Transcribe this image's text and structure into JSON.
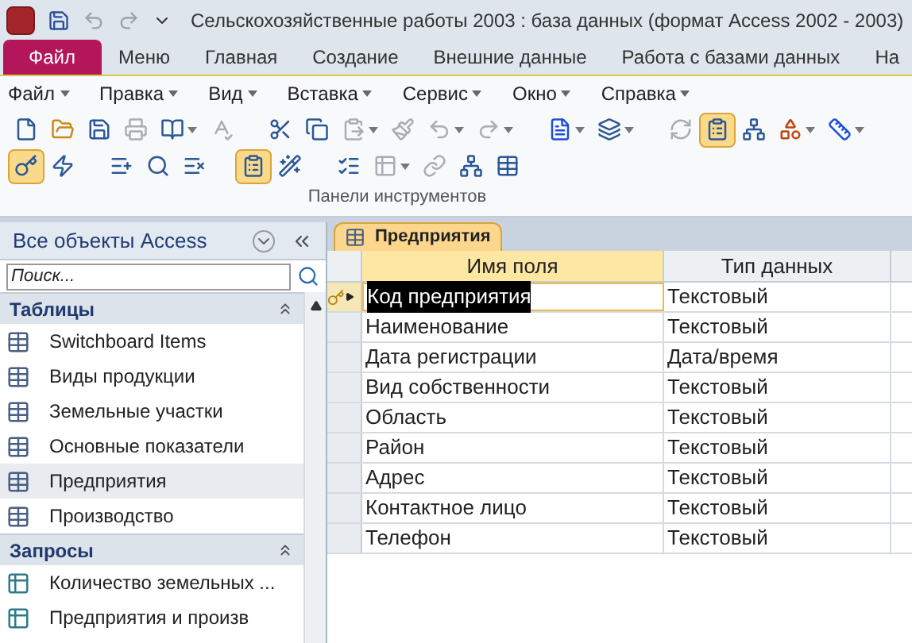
{
  "window": {
    "title": "Сельскохозяйственные работы 2003 : база данных (формат Access 2002 - 2003)"
  },
  "ribbon_tabs": [
    {
      "label": "Файл",
      "kind": "file"
    },
    {
      "label": "Меню",
      "kind": "tab"
    },
    {
      "label": "Главная",
      "kind": "tab"
    },
    {
      "label": "Создание",
      "kind": "tab"
    },
    {
      "label": "Внешние данные",
      "kind": "tab"
    },
    {
      "label": "Работа с базами данных",
      "kind": "tab"
    },
    {
      "label": "На",
      "kind": "tab"
    }
  ],
  "menu_bar": [
    "Файл",
    "Правка",
    "Вид",
    "Вставка",
    "Сервис",
    "Окно",
    "Справка"
  ],
  "toolbar_rows": [
    [
      {
        "pressed": false,
        "disabled": false,
        "dropdown": false
      },
      {
        "pressed": false,
        "disabled": false,
        "dropdown": false
      },
      {
        "pressed": false,
        "disabled": false,
        "dropdown": false
      },
      {
        "pressed": false,
        "disabled": true,
        "dropdown": false
      },
      {
        "pressed": false,
        "disabled": false,
        "dropdown": true
      },
      {
        "pressed": false,
        "disabled": true,
        "dropdown": false,
        "gap": true
      },
      {
        "pressed": false,
        "disabled": false,
        "dropdown": false
      },
      {
        "pressed": false,
        "disabled": false,
        "dropdown": false
      },
      {
        "pressed": false,
        "disabled": true,
        "dropdown": true
      },
      {
        "pressed": false,
        "disabled": true,
        "dropdown": false
      },
      {
        "pressed": false,
        "disabled": true,
        "dropdown": true
      },
      {
        "pressed": false,
        "disabled": true,
        "dropdown": true,
        "gap": true
      },
      {
        "pressed": false,
        "disabled": false,
        "dropdown": true
      },
      {
        "pressed": false,
        "disabled": false,
        "dropdown": true,
        "gap": true
      },
      {
        "pressed": false,
        "disabled": true,
        "dropdown": false
      },
      {
        "pressed": true,
        "disabled": false,
        "dropdown": false
      },
      {
        "pressed": false,
        "disabled": false,
        "dropdown": false
      },
      {
        "pressed": false,
        "disabled": false,
        "dropdown": true
      },
      {
        "pressed": false,
        "disabled": false,
        "dropdown": true
      }
    ],
    [
      {
        "pressed": true,
        "disabled": false,
        "dropdown": false
      },
      {
        "pressed": false,
        "disabled": false,
        "dropdown": false,
        "gap": true
      },
      {
        "pressed": false,
        "disabled": false,
        "dropdown": false
      },
      {
        "pressed": false,
        "disabled": false,
        "dropdown": false
      },
      {
        "pressed": false,
        "disabled": false,
        "dropdown": false,
        "gap": true
      },
      {
        "pressed": true,
        "disabled": false,
        "dropdown": false
      },
      {
        "pressed": false,
        "disabled": false,
        "dropdown": false,
        "gap": true
      },
      {
        "pressed": false,
        "disabled": false,
        "dropdown": false
      },
      {
        "pressed": false,
        "disabled": true,
        "dropdown": true
      },
      {
        "pressed": false,
        "disabled": true,
        "dropdown": false
      },
      {
        "pressed": false,
        "disabled": false,
        "dropdown": false
      },
      {
        "pressed": false,
        "disabled": false,
        "dropdown": false
      }
    ]
  ],
  "ribbon_group_label": "Панели инструментов",
  "nav_pane": {
    "title": "Все объекты Access",
    "search": {
      "placeholder": "Поиск..."
    },
    "groups": [
      {
        "label": "Таблицы",
        "kind": "table",
        "items": [
          {
            "label": "Switchboard Items",
            "selected": false
          },
          {
            "label": "Виды продукции",
            "selected": false
          },
          {
            "label": "Земельные участки",
            "selected": false
          },
          {
            "label": "Основные показатели",
            "selected": false
          },
          {
            "label": "Предприятия",
            "selected": true
          },
          {
            "label": "Производство",
            "selected": false
          }
        ]
      },
      {
        "label": "Запросы",
        "kind": "query",
        "items": [
          {
            "label": "Количество земельных ...",
            "selected": false
          },
          {
            "label": "Предприятия и произв",
            "selected": false
          }
        ]
      }
    ]
  },
  "document": {
    "tab": "Предприятия",
    "columns": [
      {
        "label": "Имя поля",
        "selected": true
      },
      {
        "label": "Тип данных",
        "selected": false
      }
    ],
    "rows": [
      {
        "field": "Код предприятия",
        "type": "Текстовый",
        "key": true,
        "selected": true
      },
      {
        "field": "Наименование",
        "type": "Текстовый",
        "key": false,
        "selected": false
      },
      {
        "field": "Дата регистрации",
        "type": "Дата/время",
        "key": false,
        "selected": false
      },
      {
        "field": "Вид собственности",
        "type": "Текстовый",
        "key": false,
        "selected": false
      },
      {
        "field": "Область",
        "type": "Текстовый",
        "key": false,
        "selected": false
      },
      {
        "field": "Район",
        "type": "Текстовый",
        "key": false,
        "selected": false
      },
      {
        "field": "Адрес",
        "type": "Текстовый",
        "key": false,
        "selected": false
      },
      {
        "field": "Контактное лицо",
        "type": "Текстовый",
        "key": false,
        "selected": false
      },
      {
        "field": "Телефон",
        "type": "Текстовый",
        "key": false,
        "selected": false
      }
    ]
  }
}
